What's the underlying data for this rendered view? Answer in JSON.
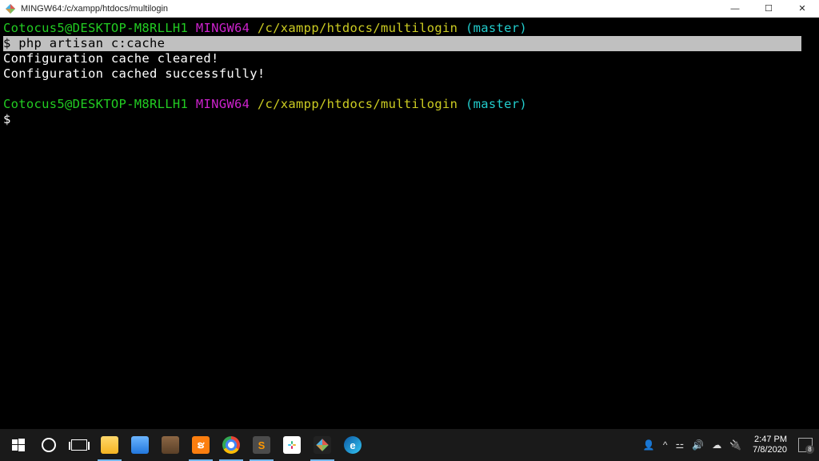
{
  "window": {
    "title": "MINGW64:/c/xampp/htdocs/multilogin"
  },
  "prompt1": {
    "user_host": "Cotocus5@DESKTOP-M8RLLH1",
    "shell": "MINGW64",
    "path": "/c/xampp/htdocs/multilogin",
    "branch": "(master)"
  },
  "command1": {
    "prompt": "$ ",
    "text": "php artisan c:cache"
  },
  "output": {
    "line1": "Configuration cache cleared!",
    "line2": "Configuration cached successfully!"
  },
  "prompt2": {
    "user_host": "Cotocus5@DESKTOP-M8RLLH1",
    "shell": "MINGW64",
    "path": "/c/xampp/htdocs/multilogin",
    "branch": "(master)"
  },
  "command2": {
    "prompt": "$"
  },
  "taskbar": {
    "time": "2:47 PM",
    "date": "7/8/2020",
    "notif_count": "8"
  },
  "glyphs": {
    "min": "—",
    "max": "☐",
    "close": "✕",
    "sublime": "S",
    "edge": "e",
    "xampp": "ຮ",
    "people": "👤",
    "chevup": "^",
    "wifi": "⚍",
    "volume": "🔊",
    "cloud": "☁",
    "power": "🔌"
  }
}
